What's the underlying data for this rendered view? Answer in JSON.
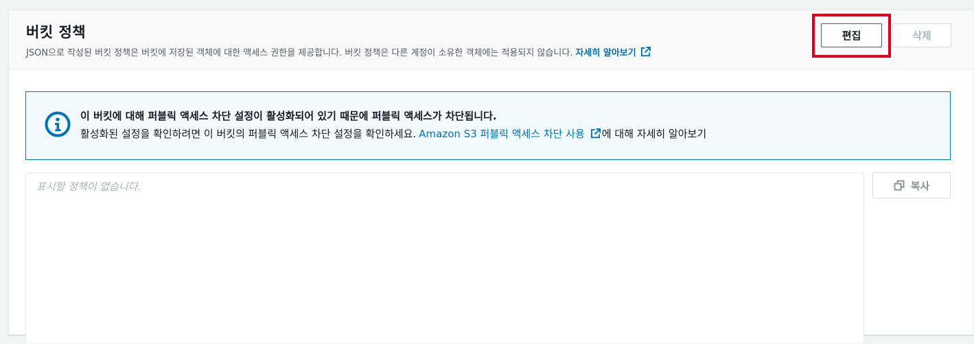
{
  "header": {
    "title": "버킷 정책",
    "description": "JSON으로 작성된 버킷 정책은 버킷에 저장된 객체에 대한 액세스 권한을 제공합니다. 버킷 정책은 다른 계정이 소유한 객체에는 적용되지 않습니다.",
    "learn_more_link": "자세히 알아보기",
    "learn_more_icon": "external-link-icon"
  },
  "actions": {
    "edit_label": "편집",
    "delete_label": "삭제",
    "edit_highlight_color": "#e3001b"
  },
  "alert": {
    "icon": "info-icon",
    "title": "이 버킷에 대해 퍼블릭 액세스 차단 설정이 활성화되어 있기 때문에 퍼블릭 액세스가 차단됩니다.",
    "body_prefix": "활성화된 설정을 확인하려면 이 버킷의 퍼블릭 액세스 차단 설정을 확인하세요.",
    "link": "Amazon S3 퍼블릭 액세스 차단 사용",
    "link_icon": "external-link-icon",
    "body_suffix": "에 대해 자세히 알아보기",
    "accent_color": "#0073bb"
  },
  "editor": {
    "placeholder": "표시할 정책이 없습니다."
  },
  "copy": {
    "label": "복사",
    "icon": "copy-icon"
  }
}
